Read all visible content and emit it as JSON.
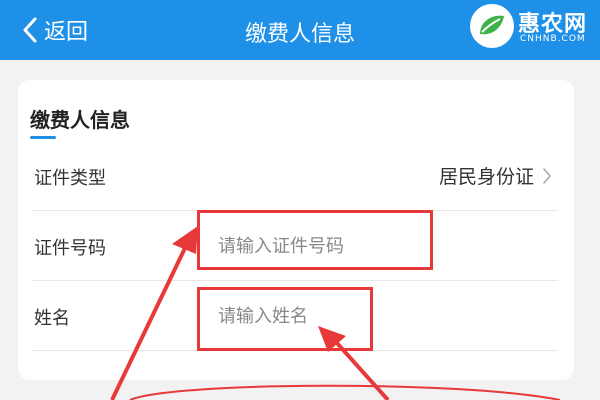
{
  "header": {
    "back_label": "返回",
    "title": "缴费人信息",
    "background_color": "#1e90e8"
  },
  "logo": {
    "text": "惠农网",
    "subtext": "CNHNB.COM"
  },
  "form": {
    "section_title": "缴费人信息",
    "id_type": {
      "label": "证件类型",
      "value": "居民身份证"
    },
    "id_number": {
      "label": "证件号码",
      "placeholder": "请输入证件号码",
      "value": ""
    },
    "name": {
      "label": "姓名",
      "placeholder": "请输入姓名",
      "value": ""
    }
  },
  "annotation_color": "#e8393a"
}
